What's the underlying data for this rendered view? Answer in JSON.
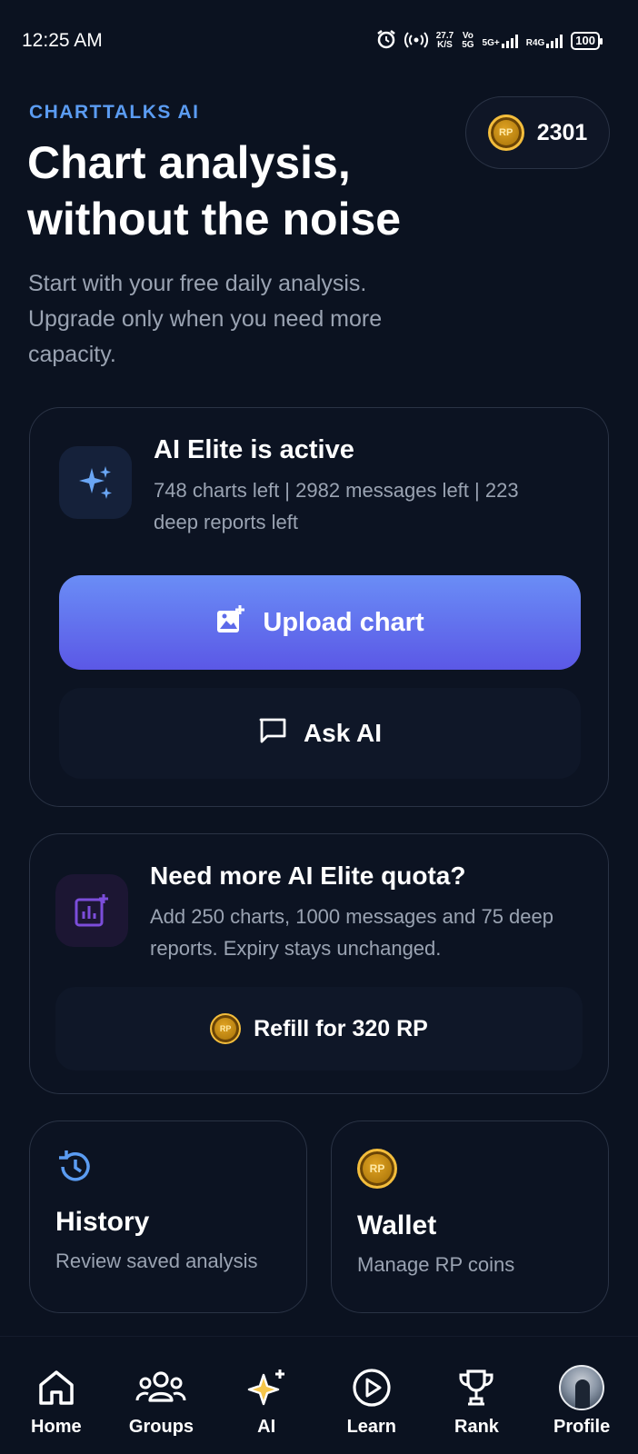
{
  "status_bar": {
    "time": "12:25 AM",
    "speed_value": "27.7",
    "speed_unit": "K/S",
    "net1_top": "Vo",
    "net1_bottom": "5G",
    "net2": "5G+",
    "net3": "R4G",
    "battery": "100"
  },
  "header": {
    "brand": "CHARTTALKS AI",
    "title": "Chart analysis, without the noise",
    "subtitle": "Start with your free daily analysis. Upgrade only when you need more capacity.",
    "rp_coin_label": "RP",
    "rp_balance": "2301"
  },
  "elite_card": {
    "title": "AI Elite is active",
    "usage": "748 charts left | 2982 messages left | 223 deep reports left",
    "upload_label": "Upload chart",
    "ask_label": "Ask AI"
  },
  "refill_card": {
    "title": "Need more AI Elite quota?",
    "description": "Add 250 charts, 1000 messages and 75 deep reports. Expiry stays unchanged.",
    "coin_label": "RP",
    "button_label": "Refill for 320 RP"
  },
  "history_card": {
    "title": "History",
    "subtitle": "Review saved analysis"
  },
  "wallet_card": {
    "coin_label": "RP",
    "title": "Wallet",
    "subtitle": "Manage RP coins"
  },
  "nav": {
    "home": "Home",
    "groups": "Groups",
    "ai": "AI",
    "learn": "Learn",
    "rank": "Rank",
    "profile": "Profile"
  },
  "colors": {
    "background": "#0b1220",
    "brand_blue": "#5b9cf2",
    "upload_gradient_top": "#6a8df6",
    "upload_gradient_bottom": "#5b58e6",
    "coin_gold": "#e0a323",
    "refill_icon_purple": "#7c4ddb"
  },
  "icons": [
    "alarm-icon",
    "hotspot-icon",
    "sparkles-icon",
    "add-image-icon",
    "chat-bubble-icon",
    "add-chart-icon",
    "rp-coin-icon",
    "history-icon",
    "home-icon",
    "groups-icon",
    "ai-sparkle-icon",
    "play-circle-icon",
    "trophy-icon",
    "avatar"
  ]
}
